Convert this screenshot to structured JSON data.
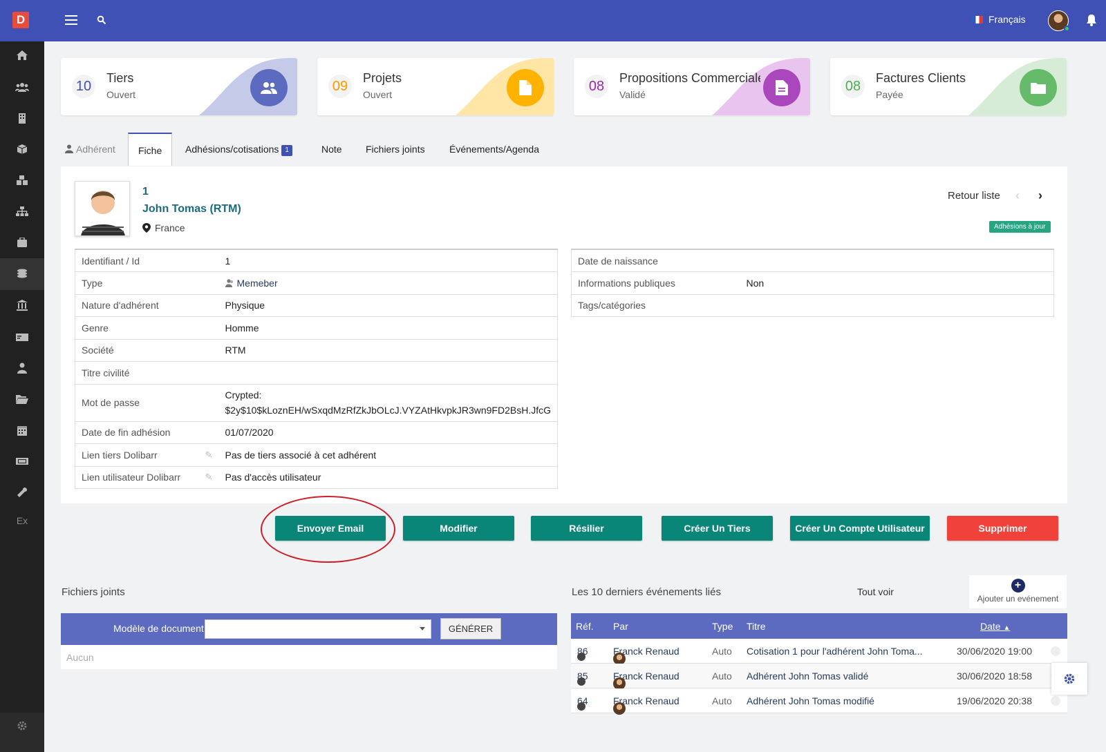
{
  "app": {
    "logo_letter": "D",
    "language": "Français",
    "accent": "#3f51b5"
  },
  "sidebar": {
    "items": [
      "home-icon",
      "users-icon",
      "building-icon",
      "box-icon",
      "cubes-icon",
      "sitemap-icon",
      "briefcase-icon",
      "coins-icon",
      "bank-icon",
      "money-icon",
      "user-tie-icon",
      "folder-open-icon",
      "calendar-icon",
      "ticket-icon",
      "wrench-icon"
    ],
    "ex_label": "Ex"
  },
  "stats": [
    {
      "num": "10",
      "title": "Tiers",
      "sub": "Ouvert",
      "color": "#5c6bc0",
      "wave": "#c5cae9",
      "numcolor": "#3f51b5"
    },
    {
      "num": "09",
      "title": "Projets",
      "sub": "Ouvert",
      "color": "#ffb300",
      "wave": "#ffe6a6",
      "numcolor": "#ff9800"
    },
    {
      "num": "08",
      "title": "Propositions Commerciales",
      "sub": "Validé",
      "color": "#ab47bc",
      "wave": "#e9c4ee",
      "numcolor": "#9c27b0"
    },
    {
      "num": "08",
      "title": "Factures Clients",
      "sub": "Payée",
      "color": "#66bb6a",
      "wave": "#d6ecd6",
      "numcolor": "#4caf50"
    }
  ],
  "tabs": {
    "member": "Adhérent",
    "fiche": "Fiche",
    "adhesions": "Adhésions/cotisations",
    "adhesions_badge": "1",
    "note": "Note",
    "files": "Fichiers joints",
    "events": "Événements/Agenda"
  },
  "member": {
    "ref": "1",
    "name": "John Tomas (RTM)",
    "country": "France",
    "back": "Retour liste",
    "status": "Adhésions à jour"
  },
  "left_table": [
    {
      "label": "Identifiant / Id",
      "value": "1"
    },
    {
      "label": "Type",
      "value": "Memeber"
    },
    {
      "label": "Nature d'adhérent",
      "value": "Physique"
    },
    {
      "label": "Genre",
      "value": "Homme"
    },
    {
      "label": "Société",
      "value": "RTM"
    },
    {
      "label": "Titre civilité",
      "value": ""
    },
    {
      "label": "Mot de passe",
      "value": "Crypted:",
      "value2": "$2y$10$kLoznEH/wSxqdMzRfZkJbOLcJ.VYZAtHkvpkJR3wn9FD2BsH.JfcG"
    },
    {
      "label": "Date de fin adhésion",
      "value": "01/07/2020"
    },
    {
      "label": "Lien tiers Dolibarr",
      "value": "Pas de tiers associé à cet adhérent"
    },
    {
      "label": "Lien utilisateur Dolibarr",
      "value": "Pas d'accès utilisateur"
    }
  ],
  "right_table": [
    {
      "label": "Date de naissance",
      "value": ""
    },
    {
      "label": "Informations publiques",
      "value": "Non"
    },
    {
      "label": "Tags/catégories",
      "value": ""
    }
  ],
  "actions": {
    "email": "Envoyer Email",
    "modify": "Modifier",
    "resign": "Résilier",
    "create_thirdparty": "Créer Un Tiers",
    "create_user": "Créer Un Compte Utilisateur",
    "delete": "Supprimer"
  },
  "files": {
    "title": "Fichiers joints",
    "model_label": "Modèle de document",
    "generate": "GÉNÉRER",
    "empty": "Aucun"
  },
  "events": {
    "title": "Les 10 derniers événements liés",
    "see_all": "Tout voir",
    "add": "Ajouter un evénement",
    "columns": {
      "ref": "Réf.",
      "by": "Par",
      "type": "Type",
      "title": "Titre",
      "date": "Date"
    },
    "rows": [
      {
        "ref": "86",
        "by": "Franck Renaud",
        "type": "Auto",
        "title": "Cotisation 1 pour l'adhérent John Toma...",
        "date": "30/06/2020 19:00"
      },
      {
        "ref": "85",
        "by": "Franck Renaud",
        "type": "Auto",
        "title": "Adhérent John Tomas validé",
        "date": "30/06/2020 18:58"
      },
      {
        "ref": "64",
        "by": "Franck Renaud",
        "type": "Auto",
        "title": "Adhérent John Tomas modifié",
        "date": "19/06/2020 20:38"
      }
    ]
  }
}
